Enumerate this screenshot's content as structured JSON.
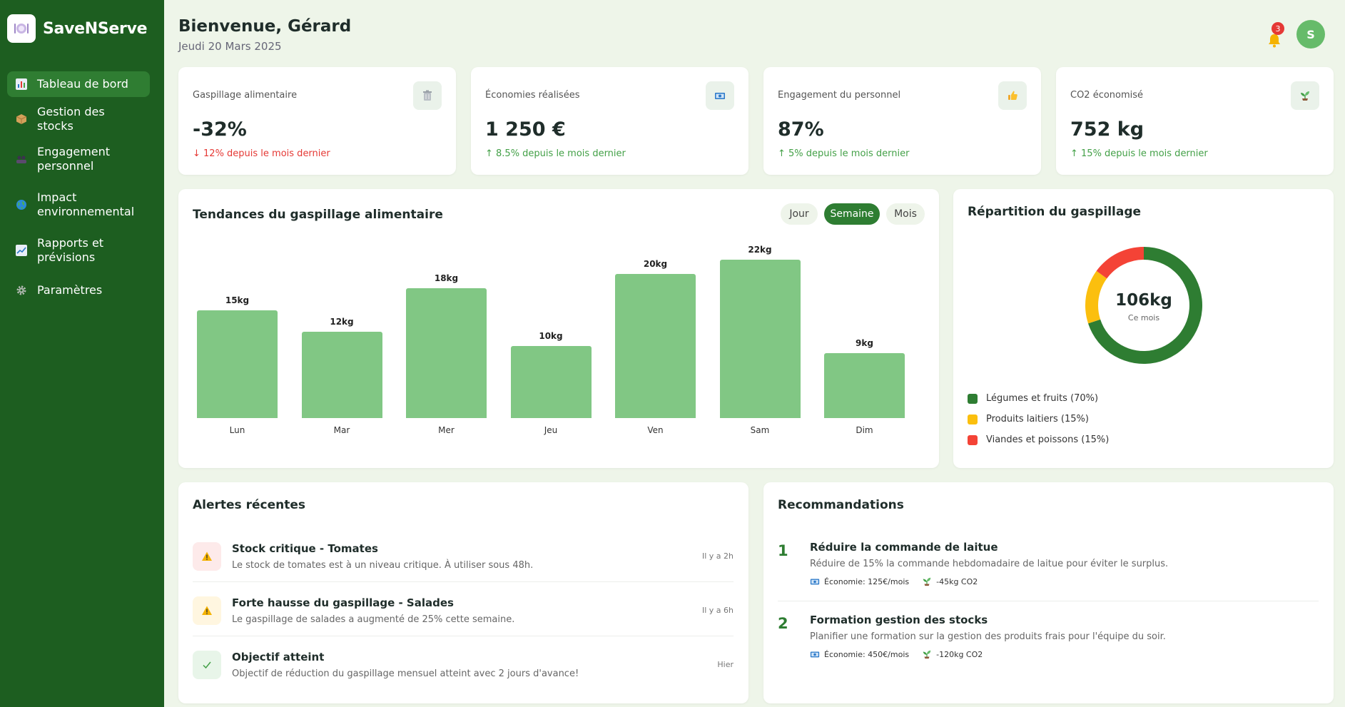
{
  "app": {
    "name": "SaveNServe"
  },
  "sidebar": {
    "items": [
      {
        "label": "Tableau de bord",
        "icon": "bar-chart-icon",
        "active": true
      },
      {
        "label": "Gestion des stocks",
        "icon": "package-icon",
        "active": false
      },
      {
        "label": "Engagement personnel",
        "icon": "team-icon",
        "active": false
      },
      {
        "label": "Impact environnemental",
        "icon": "globe-icon",
        "active": false
      },
      {
        "label": "Rapports et prévisions",
        "icon": "trend-chart-icon",
        "active": false
      },
      {
        "label": "Paramètres",
        "icon": "gear-icon",
        "active": false
      }
    ]
  },
  "header": {
    "title": "Bienvenue, Gérard",
    "date": "Jeudi 20 Mars 2025",
    "notifications": "3",
    "avatar_initial": "S"
  },
  "stats": [
    {
      "label": "Gaspillage alimentaire",
      "value": "-32%",
      "change": "↓ 12% depuis le mois dernier",
      "icon": "trash-icon",
      "trend": "down"
    },
    {
      "label": "Économies réalisées",
      "value": "1 250 €",
      "change": "↑ 8.5% depuis le mois dernier",
      "icon": "money-icon",
      "trend": "up"
    },
    {
      "label": "Engagement du personnel",
      "value": "87%",
      "change": "↑ 5% depuis le mois dernier",
      "icon": "thumbs-up-icon",
      "trend": "up"
    },
    {
      "label": "CO2 économisé",
      "value": "752 kg",
      "change": "↑ 15% depuis le mois dernier",
      "icon": "seedling-icon",
      "trend": "up"
    }
  ],
  "trends": {
    "title": "Tendances du gaspillage alimentaire",
    "periods": [
      "Jour",
      "Semaine",
      "Mois"
    ],
    "active_period": "Semaine"
  },
  "chart_data": {
    "type": "bar",
    "categories": [
      "Lun",
      "Mar",
      "Mer",
      "Jeu",
      "Ven",
      "Sam",
      "Dim"
    ],
    "values": [
      15,
      12,
      18,
      10,
      20,
      22,
      9
    ],
    "value_labels": [
      "15kg",
      "12kg",
      "18kg",
      "10kg",
      "20kg",
      "22kg",
      "9kg"
    ],
    "unit": "kg",
    "title": "Tendances du gaspillage alimentaire",
    "ylim": [
      0,
      22
    ],
    "grid": false
  },
  "breakdown": {
    "title": "Répartition du gaspillage",
    "center_value": "106kg",
    "center_label": "Ce mois",
    "slices": [
      {
        "label": "Légumes et fruits (70%)",
        "value": 70,
        "color": "#2e7d32"
      },
      {
        "label": "Produits laitiers (15%)",
        "value": 15,
        "color": "#fbbf0e"
      },
      {
        "label": "Viandes et poissons (15%)",
        "value": 15,
        "color": "#f44336"
      }
    ]
  },
  "alerts": {
    "title": "Alertes récentes",
    "items": [
      {
        "title": "Stock critique - Tomates",
        "desc": "Le stock de tomates est à un niveau critique. À utiliser sous 48h.",
        "time": "Il y a 2h",
        "icon": "warning-icon",
        "bg": "#fdeaea"
      },
      {
        "title": "Forte hausse du gaspillage - Salades",
        "desc": "Le gaspillage de salades a augmenté de 25% cette semaine.",
        "time": "Il y a 6h",
        "icon": "warning-icon",
        "bg": "#fff6e0"
      },
      {
        "title": "Objectif atteint",
        "desc": "Objectif de réduction du gaspillage mensuel atteint avec 2 jours d'avance!",
        "time": "Hier",
        "icon": "check-icon",
        "bg": "#e8f5e9"
      }
    ]
  },
  "recommendations": {
    "title": "Recommandations",
    "items": [
      {
        "num": "1",
        "title": "Réduire la commande de laitue",
        "desc": "Réduire de 15% la commande hebdomadaire de laitue pour éviter le surplus.",
        "saving": "Économie: 125€/mois",
        "co2": "-45kg CO2"
      },
      {
        "num": "2",
        "title": "Formation gestion des stocks",
        "desc": "Planifier une formation sur la gestion des produits frais pour l'équipe du soir.",
        "saving": "Économie: 450€/mois",
        "co2": "-120kg CO2"
      }
    ]
  },
  "colors": {
    "sidebar": "#1d5e20",
    "accent": "#2e7d32",
    "bar": "#81c784",
    "down": "#e53935",
    "up": "#43a047"
  }
}
